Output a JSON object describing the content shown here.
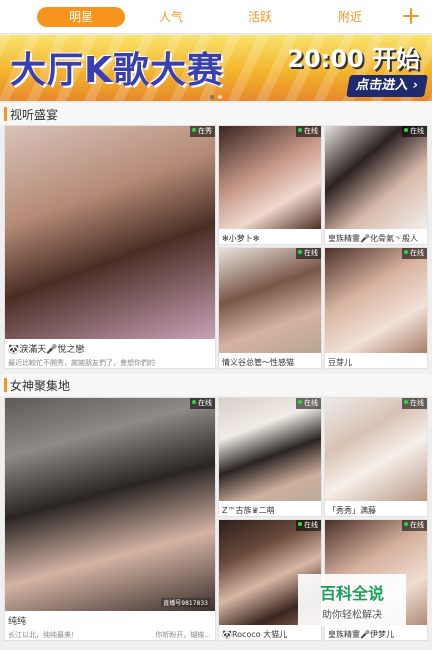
{
  "tabs": [
    {
      "label": "明星"
    },
    {
      "label": "人气"
    },
    {
      "label": "活跃"
    },
    {
      "label": "附近"
    }
  ],
  "colors": {
    "accent": "#f7941d",
    "online": "#35d34a"
  },
  "banner": {
    "title": "大厅K歌大赛",
    "time": "20:00 开始",
    "cta": "点击进入 ›"
  },
  "sections": [
    {
      "title": "视听盛宴",
      "featured": {
        "name": "🐼淚滿天🎤悅之戀",
        "desc": "最近比較忙不開秀，謝謝朋友們了，會想你們的",
        "status": "在秀"
      },
      "items": [
        {
          "name": "✻小萝卜✻",
          "status": "在线"
        },
        {
          "name": "皇族精靈🎤化骨氣丶般人",
          "status": "在线"
        },
        {
          "name": "情义谷总管～性感猫",
          "status": "在线"
        },
        {
          "name": "豆芽儿",
          "status": "在线"
        }
      ]
    },
    {
      "title": "女神聚集地",
      "featured": {
        "name": "纯纯",
        "desc": "长江以北，纯纯最美！",
        "desc_right": "你祈盼开，蝴蝶...",
        "watermark": "直播号9817833",
        "status": "在线"
      },
      "items": [
        {
          "name": "Z™古族♛二萌",
          "status": "在线"
        },
        {
          "name": "「秀秀」满藤",
          "status": "在线"
        },
        {
          "name": "🐼Rococo 大猫儿",
          "status": "在线"
        },
        {
          "name": "皇族精靈🎤伊梦儿",
          "status": "在线"
        }
      ]
    }
  ],
  "overlay": {
    "title": "百科全说",
    "subtitle": "助你轻松解决"
  },
  "icons": {
    "add": "plus-icon",
    "online": "online-dot-icon"
  }
}
